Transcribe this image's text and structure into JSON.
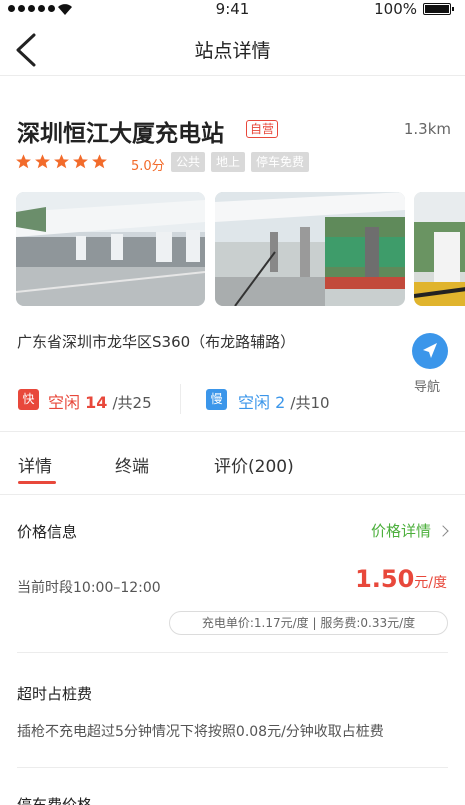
{
  "status_bar": {
    "time": "9:41",
    "battery": "100%"
  },
  "nav": {
    "title": "站点详情",
    "back_icon": "chevron-left-icon"
  },
  "station": {
    "name": "深圳恒江大厦充电站",
    "self_operated_tag": "自营",
    "distance": "1.3km",
    "rating": 5.0,
    "score_text": "5.0分",
    "tags": [
      "公共",
      "地上",
      "停车免费"
    ],
    "address": "广东省深圳市龙华区S360（布龙路辅路）",
    "navigate_label": "导航"
  },
  "availability": {
    "fast": {
      "badge": "快",
      "free_label": "空闲",
      "free": "14",
      "total": "/共25"
    },
    "slow": {
      "badge": "慢",
      "free_label": "空闲",
      "free": "2",
      "total": "/共10"
    }
  },
  "tabs": [
    "详情",
    "终端",
    "评价(200)"
  ],
  "price_info": {
    "title": "价格信息",
    "detail_link": "价格详情",
    "period": "当前时段10:00–12:00",
    "price": "1.50",
    "unit": "元/度",
    "breakdown": "充电单价:1.17元/度 | 服务费:0.33元/度"
  },
  "overtime": {
    "title": "超时占桩费",
    "desc": "插枪不充电超过5分钟情况下将按照0.08元/分钟收取占桩费"
  },
  "parking": {
    "title": "停车费价格"
  },
  "colors": {
    "accent_red": "#e8483b",
    "accent_blue": "#3b96ea",
    "accent_green": "#4caf3c",
    "star_orange": "#f26b2b"
  }
}
